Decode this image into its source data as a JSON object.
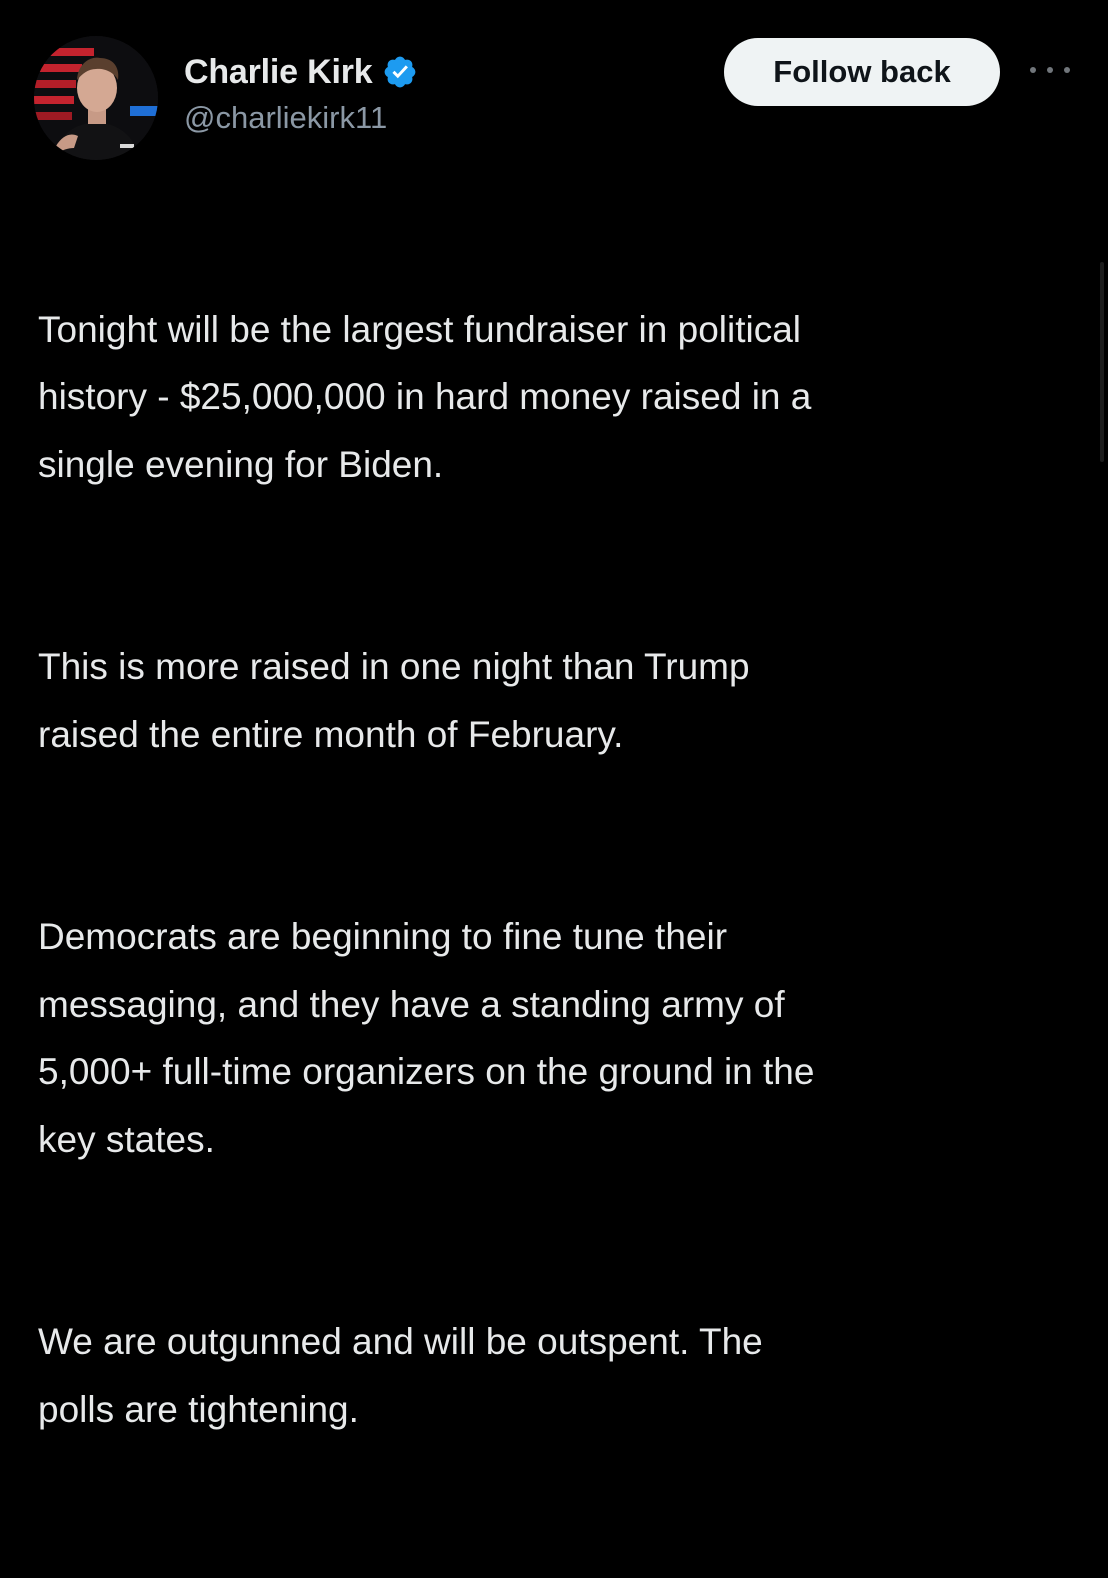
{
  "author": {
    "display_name": "Charlie Kirk",
    "handle": "@charliekirk11",
    "verified": true,
    "verified_color": "#1d9bf0"
  },
  "actions": {
    "follow_label": "Follow back",
    "more_icon": "more-horizontal-icon"
  },
  "tweet": {
    "paragraphs": [
      "Tonight will be the largest fundraiser in political\nhistory - $25,000,000 in hard money raised in a\nsingle evening for Biden.",
      "This is more raised in one night than Trump\nraised the entire month of February.",
      "Democrats are beginning to fine tune their\nmessaging, and they have a standing army of\n5,000+ full-time organizers on the ground in the\nkey states.",
      "We are outgunned and will be outspent. The\npolls are tightening."
    ]
  },
  "colors": {
    "background": "#000000",
    "text": "#e7e9ea",
    "secondary_text": "#8b98a5",
    "button_bg": "#eff3f4",
    "button_text": "#0f1419"
  }
}
